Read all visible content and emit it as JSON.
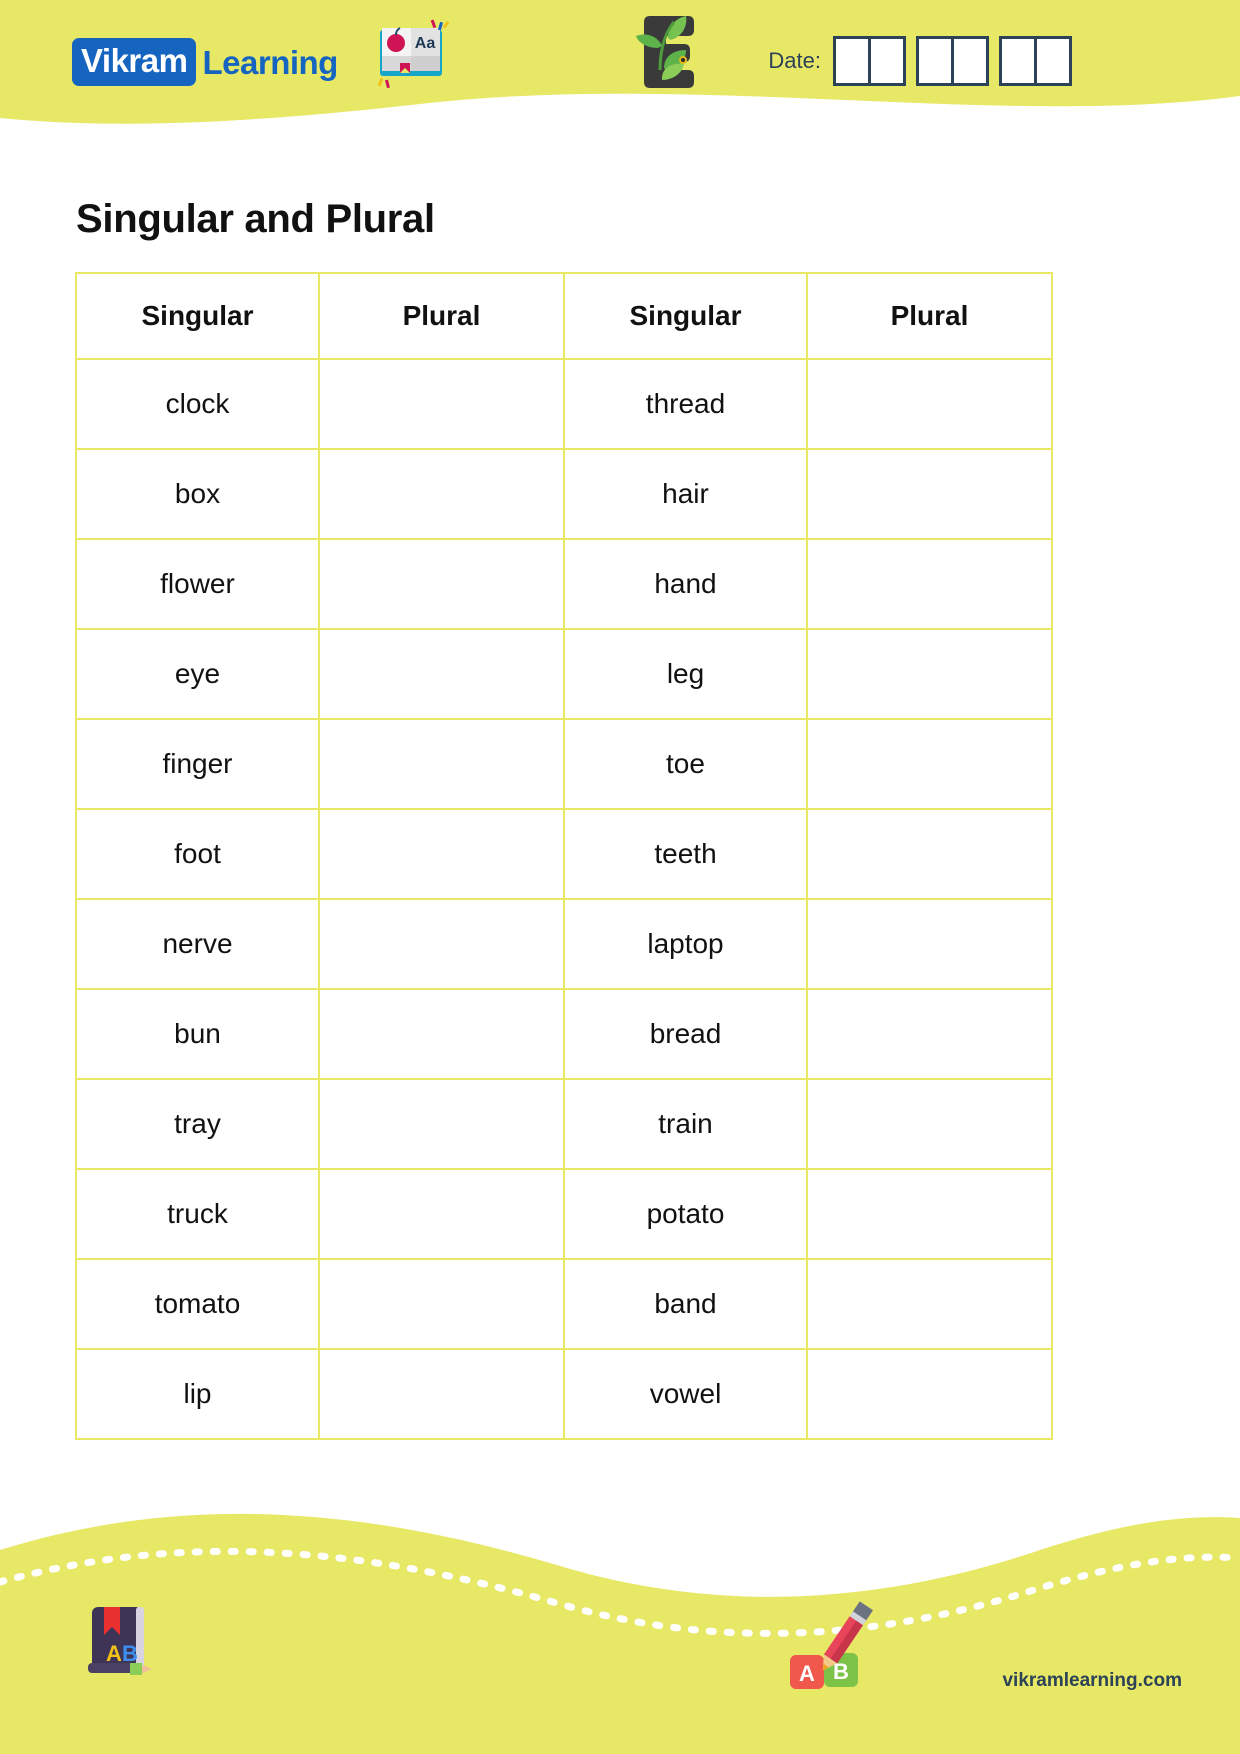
{
  "header": {
    "logo": {
      "badge_text": "Vikram",
      "word_text": "Learning",
      "badge_color": "#1565c0"
    },
    "book_icon_name": "open-book-icon",
    "eco_icon_name": "eco-leaf-e-icon",
    "date": {
      "label": "Date:",
      "groups": 3,
      "boxes_per_group": 2,
      "values": [
        "",
        "",
        "",
        "",
        "",
        ""
      ]
    },
    "background_color": "#e8e867"
  },
  "title": "Singular and Plural",
  "table": {
    "headers": [
      "Singular",
      "Plural",
      "Singular",
      "Plural"
    ],
    "border_color": "#e8e862",
    "rows": [
      {
        "singular_a": "clock",
        "plural_a": "",
        "singular_b": "thread",
        "plural_b": ""
      },
      {
        "singular_a": "box",
        "plural_a": "",
        "singular_b": "hair",
        "plural_b": ""
      },
      {
        "singular_a": "flower",
        "plural_a": "",
        "singular_b": "hand",
        "plural_b": ""
      },
      {
        "singular_a": "eye",
        "plural_a": "",
        "singular_b": "leg",
        "plural_b": ""
      },
      {
        "singular_a": "finger",
        "plural_a": "",
        "singular_b": "toe",
        "plural_b": ""
      },
      {
        "singular_a": "foot",
        "plural_a": "",
        "singular_b": "teeth",
        "plural_b": ""
      },
      {
        "singular_a": "nerve",
        "plural_a": "",
        "singular_b": "laptop",
        "plural_b": ""
      },
      {
        "singular_a": "bun",
        "plural_a": "",
        "singular_b": "bread",
        "plural_b": ""
      },
      {
        "singular_a": "tray",
        "plural_a": "",
        "singular_b": "train",
        "plural_b": ""
      },
      {
        "singular_a": "truck",
        "plural_a": "",
        "singular_b": "potato",
        "plural_b": ""
      },
      {
        "singular_a": "tomato",
        "plural_a": "",
        "singular_b": "band",
        "plural_b": ""
      },
      {
        "singular_a": "lip",
        "plural_a": "",
        "singular_b": "vowel",
        "plural_b": ""
      }
    ]
  },
  "footer": {
    "url": "vikramlearning.com",
    "ab_book_icon_name": "ab-book-pencil-icon",
    "ab_blocks_icon_name": "ab-blocks-pencil-icon",
    "letter_a": "A",
    "letter_b": "B",
    "background_color": "#e8e867"
  }
}
